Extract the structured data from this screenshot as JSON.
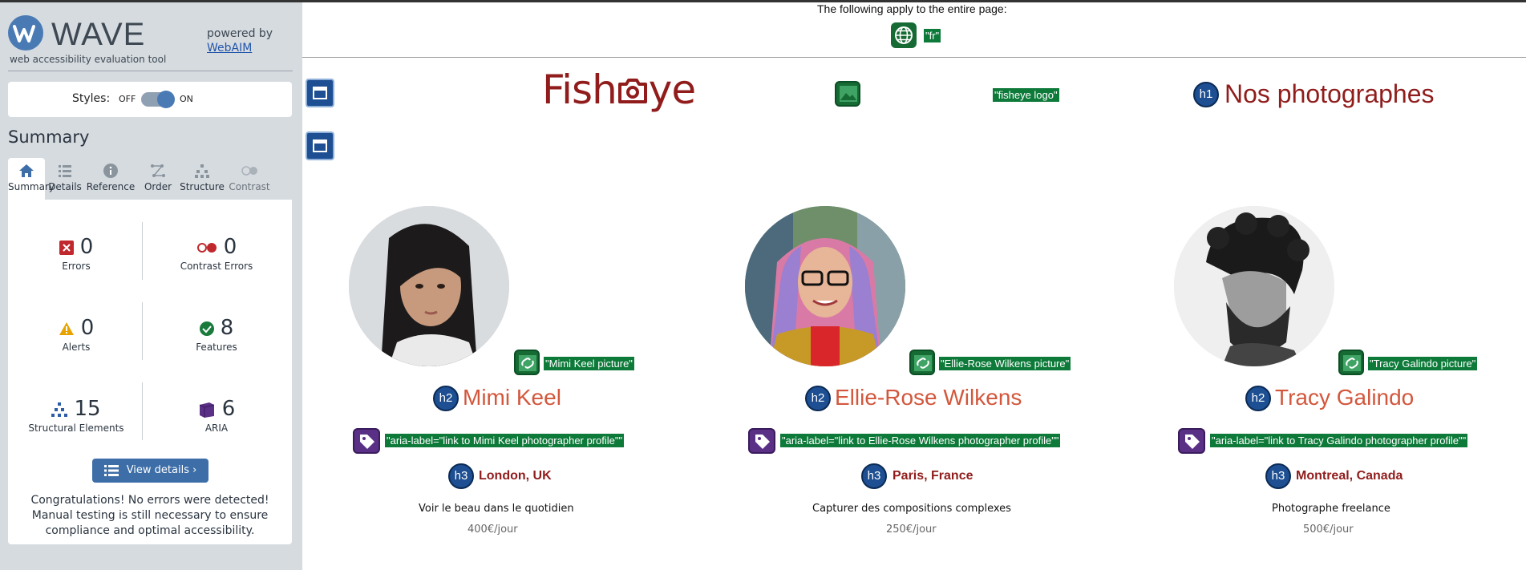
{
  "wave": {
    "title": "WAVE",
    "subtitle": "web accessibility evaluation tool",
    "powered_by": "powered by",
    "webaim_link": "WebAIM",
    "styles_label": "Styles:",
    "off_label": "OFF",
    "on_label": "ON",
    "summary_heading": "Summary",
    "tabs": [
      {
        "label": "Summary",
        "icon": "home-icon",
        "active": true
      },
      {
        "label": "Details",
        "icon": "list-icon",
        "active": false
      },
      {
        "label": "Reference",
        "icon": "info-icon",
        "active": false
      },
      {
        "label": "Order",
        "icon": "order-icon",
        "active": false
      },
      {
        "label": "Structure",
        "icon": "structure-icon",
        "active": false
      },
      {
        "label": "Contrast",
        "icon": "contrast-icon",
        "active": false
      }
    ],
    "stats": {
      "errors": {
        "count": "0",
        "label": "Errors",
        "color": "#c0282d"
      },
      "contrast_errors": {
        "count": "0",
        "label": "Contrast Errors",
        "color": "#c0282d"
      },
      "alerts": {
        "count": "0",
        "label": "Alerts",
        "color": "#e8a300"
      },
      "features": {
        "count": "8",
        "label": "Features",
        "color": "#1a7a3c"
      },
      "structural": {
        "count": "15",
        "label": "Structural Elements",
        "color": "#2d5da8"
      },
      "aria": {
        "count": "6",
        "label": "ARIA",
        "color": "#5a2f86"
      }
    },
    "view_details": "View details ›",
    "congrats": "Congratulations! No errors were detected! Manual testing is still necessary to ensure compliance and optimal accessibility."
  },
  "page": {
    "page_note": "The following apply to the entire page:",
    "lang_tag": "\"fr\"",
    "logo_text": "Fisheye",
    "logo_alt_tag": "\"fisheye logo\"",
    "h1_badge": "h1",
    "h1_text": "Nos photographes",
    "photographers": [
      {
        "alt_tag": "\"Mimi Keel picture\"",
        "h2_badge": "h2",
        "name": "Mimi Keel",
        "aria_tag": "\"aria-label=\"link to Mimi Keel photographer profile\"\"",
        "h3_badge": "h3",
        "location": "London, UK",
        "tagline": "Voir le beau dans le quotidien",
        "price": "400€/jour"
      },
      {
        "alt_tag": "\"Ellie-Rose Wilkens picture\"",
        "h2_badge": "h2",
        "name": "Ellie-Rose Wilkens",
        "aria_tag": "\"aria-label=\"link to Ellie-Rose Wilkens photographer profile\"\"",
        "h3_badge": "h3",
        "location": "Paris, France",
        "tagline": "Capturer des compositions complexes",
        "price": "250€/jour"
      },
      {
        "alt_tag": "\"Tracy Galindo picture\"",
        "h2_badge": "h2",
        "name": "Tracy Galindo",
        "aria_tag": "\"aria-label=\"link to Tracy Galindo photographer profile\"\"",
        "h3_badge": "h3",
        "location": "Montreal, Canada",
        "tagline": "Photographe freelance",
        "price": "500€/jour"
      }
    ]
  }
}
